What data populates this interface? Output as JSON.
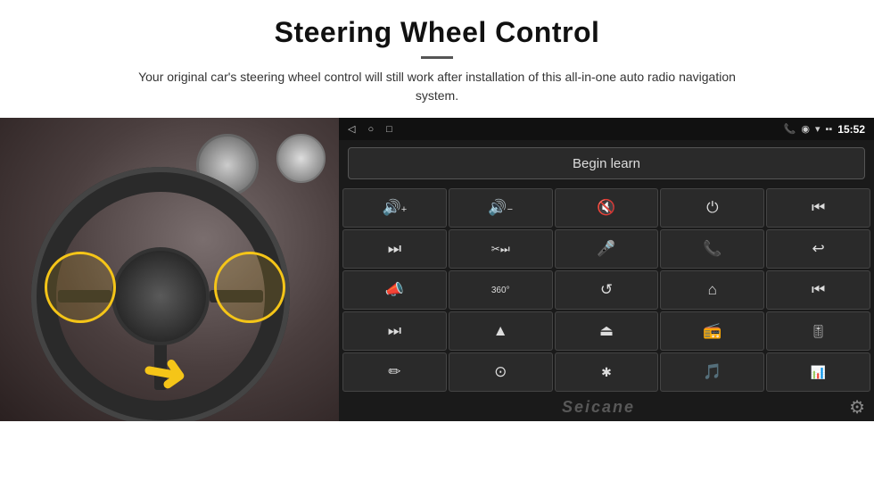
{
  "header": {
    "title": "Steering Wheel Control",
    "subtitle": "Your original car's steering wheel control will still work after installation of this all-in-one auto radio navigation system."
  },
  "status_bar": {
    "time": "15:52",
    "back_icon": "◁",
    "home_icon": "○",
    "recents_icon": "□",
    "signal_icon": "▪▪",
    "wifi_icon": "▾",
    "phone_icon": "📞",
    "location_icon": "◉"
  },
  "begin_learn": {
    "label": "Begin learn"
  },
  "controls": [
    {
      "icon": "🔊+",
      "name": "vol-up"
    },
    {
      "icon": "🔊-",
      "name": "vol-down"
    },
    {
      "icon": "🔇",
      "name": "mute"
    },
    {
      "icon": "⏻",
      "name": "power"
    },
    {
      "icon": "⏮",
      "name": "prev-track"
    },
    {
      "icon": "⏭",
      "name": "next"
    },
    {
      "icon": "✂⏭",
      "name": "skip"
    },
    {
      "icon": "🎤",
      "name": "mic"
    },
    {
      "icon": "📞",
      "name": "call"
    },
    {
      "icon": "↩",
      "name": "hangup"
    },
    {
      "icon": "📣",
      "name": "speaker"
    },
    {
      "icon": "360°",
      "name": "360"
    },
    {
      "icon": "↺",
      "name": "back"
    },
    {
      "icon": "⌂",
      "name": "home"
    },
    {
      "icon": "⏮⏮",
      "name": "rew"
    },
    {
      "icon": "⏭⏭",
      "name": "ff"
    },
    {
      "icon": "▲",
      "name": "nav"
    },
    {
      "icon": "⏏",
      "name": "source"
    },
    {
      "icon": "📻",
      "name": "radio"
    },
    {
      "icon": "🎚",
      "name": "eq"
    },
    {
      "icon": "✏",
      "name": "draw"
    },
    {
      "icon": "⊙",
      "name": "settings"
    },
    {
      "icon": "✱",
      "name": "bluetooth"
    },
    {
      "icon": "🎵",
      "name": "music"
    },
    {
      "icon": "📊",
      "name": "spectrum"
    }
  ],
  "footer": {
    "watermark": "Seicane",
    "gear_icon": "⚙"
  }
}
